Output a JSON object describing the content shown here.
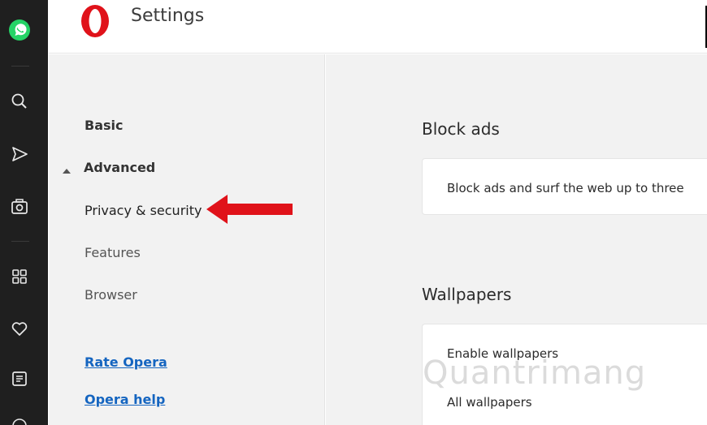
{
  "header": {
    "title": "Settings"
  },
  "nav": {
    "basic": "Basic",
    "advanced": "Advanced",
    "privacy": "Privacy & security",
    "features": "Features",
    "browser": "Browser",
    "rate_opera": "Rate Opera",
    "opera_help": "Opera help"
  },
  "main": {
    "block_ads": {
      "title": "Block ads",
      "description": "Block ads and surf the web up to three"
    },
    "wallpapers": {
      "title": "Wallpapers",
      "enable": "Enable wallpapers",
      "all": "All wallpapers"
    }
  },
  "watermark": "Quantrimang",
  "sidebar_icons": [
    "whatsapp-icon",
    "search-icon",
    "send-icon",
    "camera-icon",
    "apps-icon",
    "heart-icon",
    "news-icon"
  ],
  "colors": {
    "opera_red": "#e0121a",
    "link": "#1565c0",
    "whatsapp": "#25d366",
    "sidebar": "#1f1f1f"
  }
}
